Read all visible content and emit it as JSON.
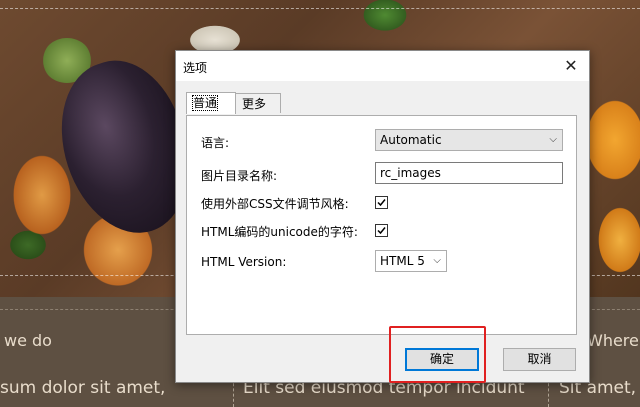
{
  "background": {
    "left_heading": "we do",
    "left_text": "sum dolor sit amet,",
    "middle_text": "Elit sed eiusmod tempor incidunt",
    "right_heading": "Where",
    "right_text": "Sit amet,"
  },
  "dialog": {
    "title": "选项",
    "tabs": [
      {
        "label": "普通",
        "active": true
      },
      {
        "label": "更多",
        "active": false
      }
    ],
    "language_label": "语言:",
    "language_value": "Automatic",
    "image_dir_label": "图片目录名称:",
    "image_dir_value": "rc_images",
    "external_css_label": "使用外部CSS文件调节风格:",
    "external_css_checked": true,
    "unicode_label": "HTML编码的unicode的字符:",
    "unicode_checked": true,
    "html_version_label": "HTML Version:",
    "html_version_value": "HTML 5",
    "ok_label": "确定",
    "cancel_label": "取消"
  },
  "colors": {
    "accent": "#0078d7",
    "highlight": "#e02020"
  }
}
